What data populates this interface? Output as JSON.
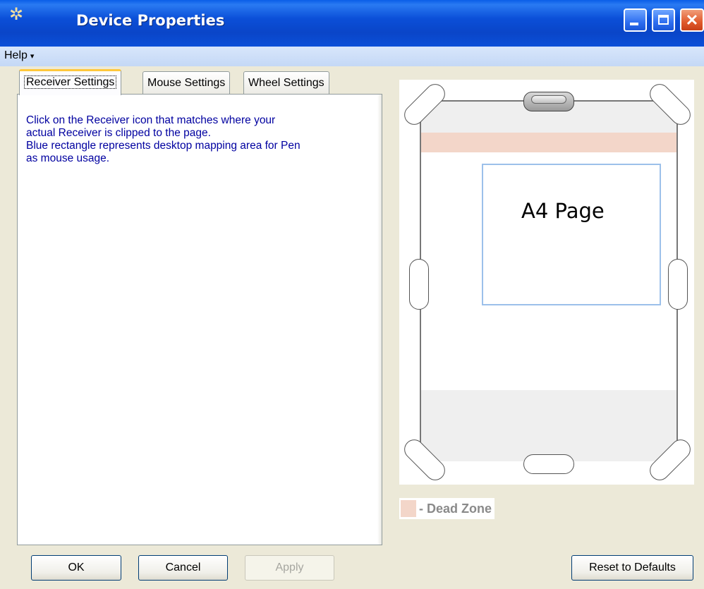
{
  "window": {
    "title": "Device Properties",
    "buttons": {
      "minimize": "minimize-icon",
      "maximize": "maximize-icon",
      "close": "close-icon"
    }
  },
  "menu": {
    "help_label": "Help",
    "help_arrow": "▾"
  },
  "tabs": [
    {
      "label": "Receiver Settings",
      "active": true
    },
    {
      "label": "Mouse Settings",
      "active": false
    },
    {
      "label": "Wheel Settings",
      "active": false
    }
  ],
  "panel": {
    "instructions": [
      "Click on the Receiver icon that matches where your",
      "actual Receiver is clipped to the page.",
      "Blue rectangle represents desktop mapping area for Pen",
      "as mouse usage."
    ]
  },
  "diagram": {
    "page_label": "A4 Page",
    "legend_text": "- Dead Zone",
    "colors": {
      "dead_zone": "#f3d6c9",
      "mapping_area": "#9cc0ea"
    }
  },
  "buttons": {
    "ok": "OK",
    "cancel": "Cancel",
    "apply": "Apply",
    "reset": "Reset to Defaults"
  }
}
